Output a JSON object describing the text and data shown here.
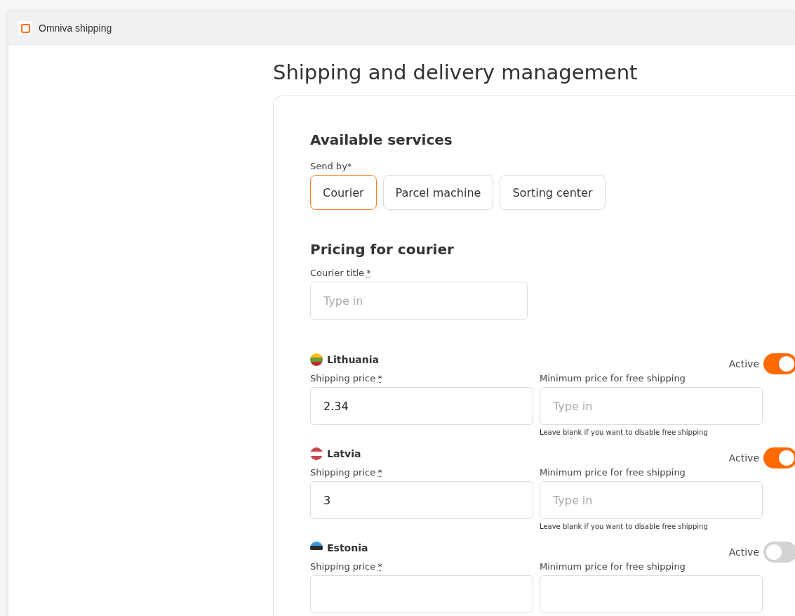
{
  "app_bar": {
    "title": "Omniva shipping"
  },
  "page_title": "Shipping and delivery management",
  "services": {
    "heading": "Available services",
    "send_by_label": "Send by*",
    "options": [
      {
        "label": "Courier",
        "selected": true
      },
      {
        "label": "Parcel machine",
        "selected": false
      },
      {
        "label": "Sorting center",
        "selected": false
      }
    ]
  },
  "pricing": {
    "heading": "Pricing for courier",
    "title_label": "Courier title",
    "required_mark": "*",
    "title_placeholder": "Type in"
  },
  "countries": [
    {
      "name": "Lithuania",
      "active_label": "Active",
      "active": true,
      "price_label": "Shipping price",
      "price_required": "*",
      "price_value": "2.34",
      "free_label": "Minimum price for free shipping",
      "free_placeholder": "Type in",
      "hint": "Leave blank if you want to disable free shipping"
    },
    {
      "name": "Latvia",
      "active_label": "Active",
      "active": true,
      "price_label": "Shipping price",
      "price_required": "*",
      "price_value": "3",
      "free_label": "Minimum price for free shipping",
      "free_placeholder": "Type in",
      "hint": "Leave blank if you want to disable free shipping"
    },
    {
      "name": "Estonia",
      "active_label": "Active",
      "active": false,
      "price_label": "Shipping price",
      "price_required": "*",
      "free_label": "Minimum price for free shipping"
    }
  ]
}
